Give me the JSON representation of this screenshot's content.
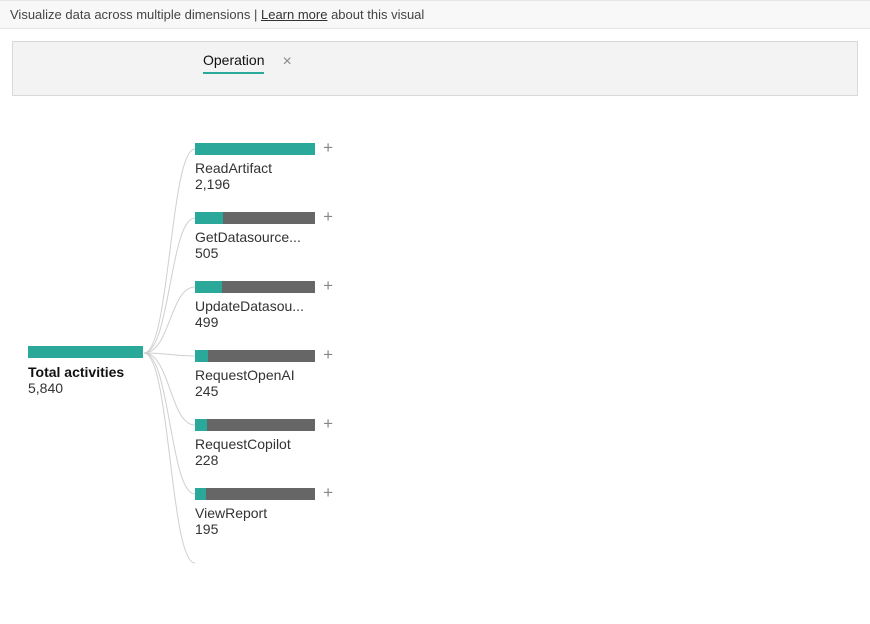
{
  "header": {
    "description_pre": "Visualize data across multiple dimensions | ",
    "learn_more": "Learn more",
    "description_post": " about this visual"
  },
  "filter": {
    "label": "Operation"
  },
  "root": {
    "title": "Total activities",
    "value_label": "5,840",
    "value": 5840
  },
  "children": [
    {
      "label": "ReadArtifact",
      "value_label": "2,196",
      "value": 2196,
      "top": 43
    },
    {
      "label": "GetDatasource...",
      "value_label": "505",
      "value": 505,
      "top": 112
    },
    {
      "label": "UpdateDatasou...",
      "value_label": "499",
      "value": 499,
      "top": 181
    },
    {
      "label": "RequestOpenAI",
      "value_label": "245",
      "value": 245,
      "top": 250
    },
    {
      "label": "RequestCopilot",
      "value_label": "228",
      "value": 228,
      "top": 319
    },
    {
      "label": "ViewReport",
      "value_label": "195",
      "value": 195,
      "top": 388
    }
  ],
  "chart_data": {
    "type": "bar",
    "title": "Total activities by Operation",
    "root_label": "Total activities",
    "root_value": 5840,
    "dimension": "Operation",
    "categories": [
      "ReadArtifact",
      "GetDatasource...",
      "UpdateDatasou...",
      "RequestOpenAI",
      "RequestCopilot",
      "ViewReport"
    ],
    "values": [
      2196,
      505,
      499,
      245,
      228,
      195
    ],
    "ylim": [
      0,
      2196
    ]
  },
  "colors": {
    "accent": "#2aa89a",
    "bar_track": "#666666"
  }
}
